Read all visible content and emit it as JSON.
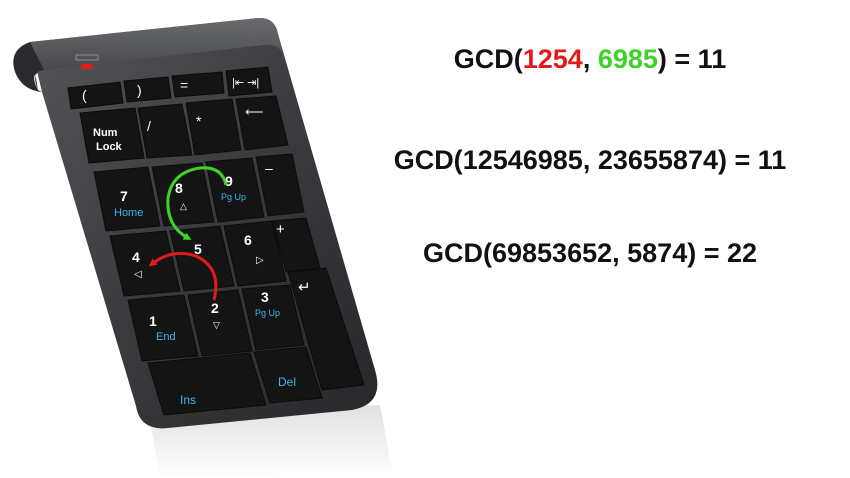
{
  "colors": {
    "red_arrow": "#e11b1b",
    "green_arrow": "#3fd12a",
    "secondary_label": "#3fb6e8",
    "key": "#141414",
    "body": "#3a3b3e",
    "led": "#e11b1b"
  },
  "equations": [
    {
      "prefix": "GCD(",
      "a": "1254",
      "sep": ", ",
      "b": "6985",
      "suffix": ") = 11"
    },
    {
      "prefix": "GCD(",
      "a": "12546985",
      "sep": ", ",
      "b": "23655874",
      "suffix": ") = 11"
    },
    {
      "prefix": "GCD(",
      "a": "69853652",
      "sep": ", ",
      "b": "5874",
      "suffix": ") = 22"
    }
  ],
  "keypad": {
    "keys": [
      {
        "name": "key-left-paren",
        "label": "("
      },
      {
        "name": "key-right-paren",
        "label": ")"
      },
      {
        "name": "key-equals",
        "label": "="
      },
      {
        "name": "key-tab",
        "label": "|⇤  ⇥|"
      },
      {
        "name": "key-num-lock",
        "label": "Num",
        "label2": "Lock"
      },
      {
        "name": "key-divide",
        "label": "/"
      },
      {
        "name": "key-multiply",
        "label": "*"
      },
      {
        "name": "key-backspace",
        "label": "⟵"
      },
      {
        "name": "key-7",
        "label": "7",
        "secondary": "Home"
      },
      {
        "name": "key-8",
        "label": "8",
        "arrow": "△"
      },
      {
        "name": "key-9",
        "label": "9",
        "secondary": "Pg Up"
      },
      {
        "name": "key-minus",
        "label": "–"
      },
      {
        "name": "key-4",
        "label": "4",
        "arrow": "◁"
      },
      {
        "name": "key-5",
        "label": "5"
      },
      {
        "name": "key-6",
        "label": "6",
        "arrow": "▷"
      },
      {
        "name": "key-plus",
        "label": "+"
      },
      {
        "name": "key-1",
        "label": "1",
        "secondary": "End"
      },
      {
        "name": "key-2",
        "label": "2",
        "arrow": "▽"
      },
      {
        "name": "key-3",
        "label": "3",
        "secondary": "Pg Up"
      },
      {
        "name": "key-enter",
        "label": "↵"
      },
      {
        "name": "key-ins",
        "label": "",
        "secondary": "Ins"
      },
      {
        "name": "key-del",
        "label": "",
        "secondary": "Del"
      }
    ]
  }
}
